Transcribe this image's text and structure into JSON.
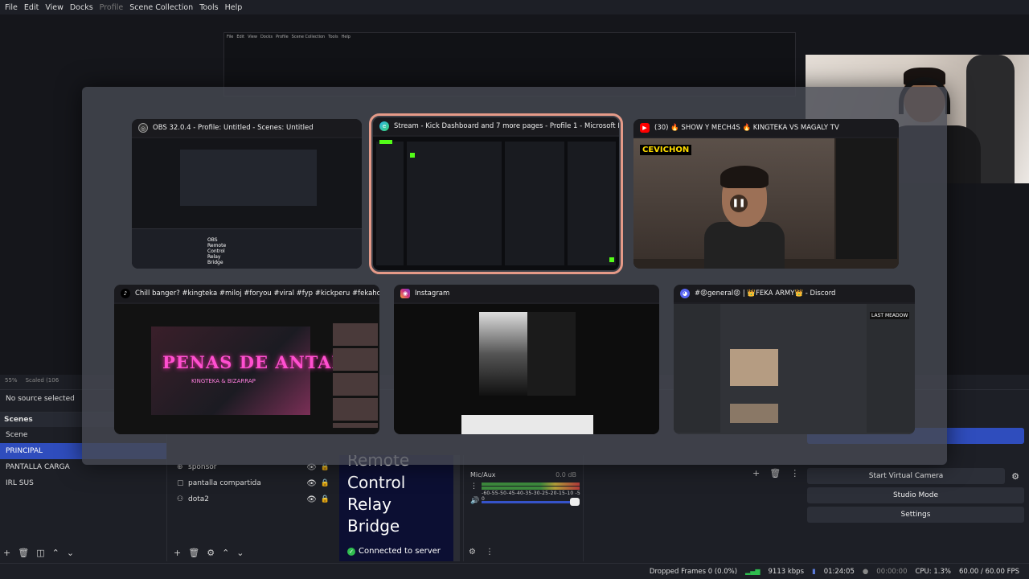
{
  "menu": [
    "File",
    "Edit",
    "View",
    "Docks",
    "Profile",
    "Scene Collection",
    "Tools",
    "Help"
  ],
  "mini_menu": [
    "File",
    "Edit",
    "View",
    "Docks",
    "Profile",
    "Scene Collection",
    "Tools",
    "Help"
  ],
  "preview_status": {
    "zoom": "55%",
    "scaled": "Scaled (106"
  },
  "no_source": "No source selected",
  "scenes": {
    "title": "Scenes",
    "items": [
      "Scene",
      "PRINCIPAL",
      "PANTALLA CARGA",
      "IRL SUS"
    ],
    "active": "PRINCIPAL"
  },
  "sources": [
    {
      "name": "sponsor",
      "icon": "browser-icon"
    },
    {
      "name": "pantalla compartida",
      "icon": "window-capture-icon"
    },
    {
      "name": "dota2",
      "icon": "game-capture-icon"
    }
  ],
  "browser_source": {
    "lines": [
      "Remote",
      "Control",
      "Relay",
      "Bridge"
    ],
    "status": "Connected to server"
  },
  "mixer": {
    "label": "Mic/Aux",
    "db": "0.0 dB",
    "ticks": "-60-55-50-45-40-35-30-25-20-15-10 -5 0"
  },
  "controls": {
    "virtual_camera": "Start Virtual Camera",
    "studio_mode": "Studio Mode",
    "settings": "Settings"
  },
  "status_bar": {
    "dropped": "Dropped Frames 0 (0.0%)",
    "bitrate": "9113 kbps",
    "stream_time": "01:24:05",
    "rec_time": "00:00:00",
    "cpu": "CPU: 1.3%",
    "fps": "60.00 / 60.00 FPS"
  },
  "switcher": {
    "windows": [
      {
        "title": "OBS 32.0.4 - Profile: Untitled - Scenes: Untitled",
        "icon": "obs-icon",
        "thumb_text": [
          "OBS",
          "Remote",
          "Control",
          "Relay",
          "Bridge"
        ]
      },
      {
        "title": "Stream - Kick Dashboard and 7 more pages - Profile 1 - Microsoft Edge",
        "icon": "edge-icon",
        "selected": true
      },
      {
        "title": "(30) 🔥 SHOW Y MECH4S 🔥 KINGTEKA VS MAGALY TV",
        "icon": "youtube-icon",
        "thumb_text": [
          "CEVICHON"
        ]
      },
      {
        "title": "Chill banger? #kingteka #miloj #foryou #viral #fyp #kickperu #fekahous... | TikTok",
        "icon": "tiktok-icon",
        "thumb_text": [
          "PENAS DE ANTAÑO",
          "KINGTEKA & BIZARRAP"
        ]
      },
      {
        "title": "Instagram",
        "icon": "instagram-icon"
      },
      {
        "title": "#😡general😡 | 👑FEKA ARMY👑 - Discord",
        "icon": "discord-icon",
        "thumb_text": [
          "LAST MEADOW"
        ]
      }
    ]
  },
  "colors": {
    "accent": "#2f4dbd",
    "selected_outline": "#e59a88",
    "kick_green": "#53fc18",
    "connected": "#2fbd4f"
  }
}
